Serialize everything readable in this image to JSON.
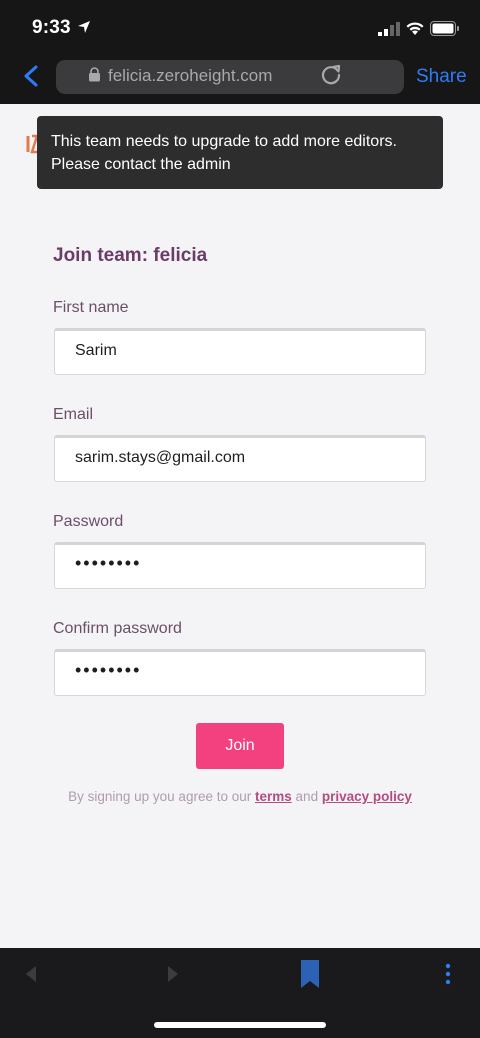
{
  "status_bar": {
    "time": "9:33"
  },
  "browser": {
    "url": "felicia.zeroheight.com",
    "share_label": "Share"
  },
  "toast": {
    "message": "This team needs to upgrade to add more editors. Please contact the admin"
  },
  "form": {
    "title": "Join team: felicia",
    "fields": [
      {
        "label": "First name",
        "value": "Sarim"
      },
      {
        "label": "Email",
        "value": "sarim.stays@gmail.com"
      },
      {
        "label": "Password",
        "value": "••••••••"
      },
      {
        "label": "Confirm password",
        "value": "••••••••"
      }
    ],
    "submit_label": "Join",
    "terms_prefix": "By signing up you agree to our",
    "terms_link": "terms",
    "terms_and": "and",
    "privacy_link": "privacy policy"
  },
  "colors": {
    "accent": "#f3407f",
    "title": "#6b3d66",
    "ios_blue": "#2e7cf6"
  }
}
